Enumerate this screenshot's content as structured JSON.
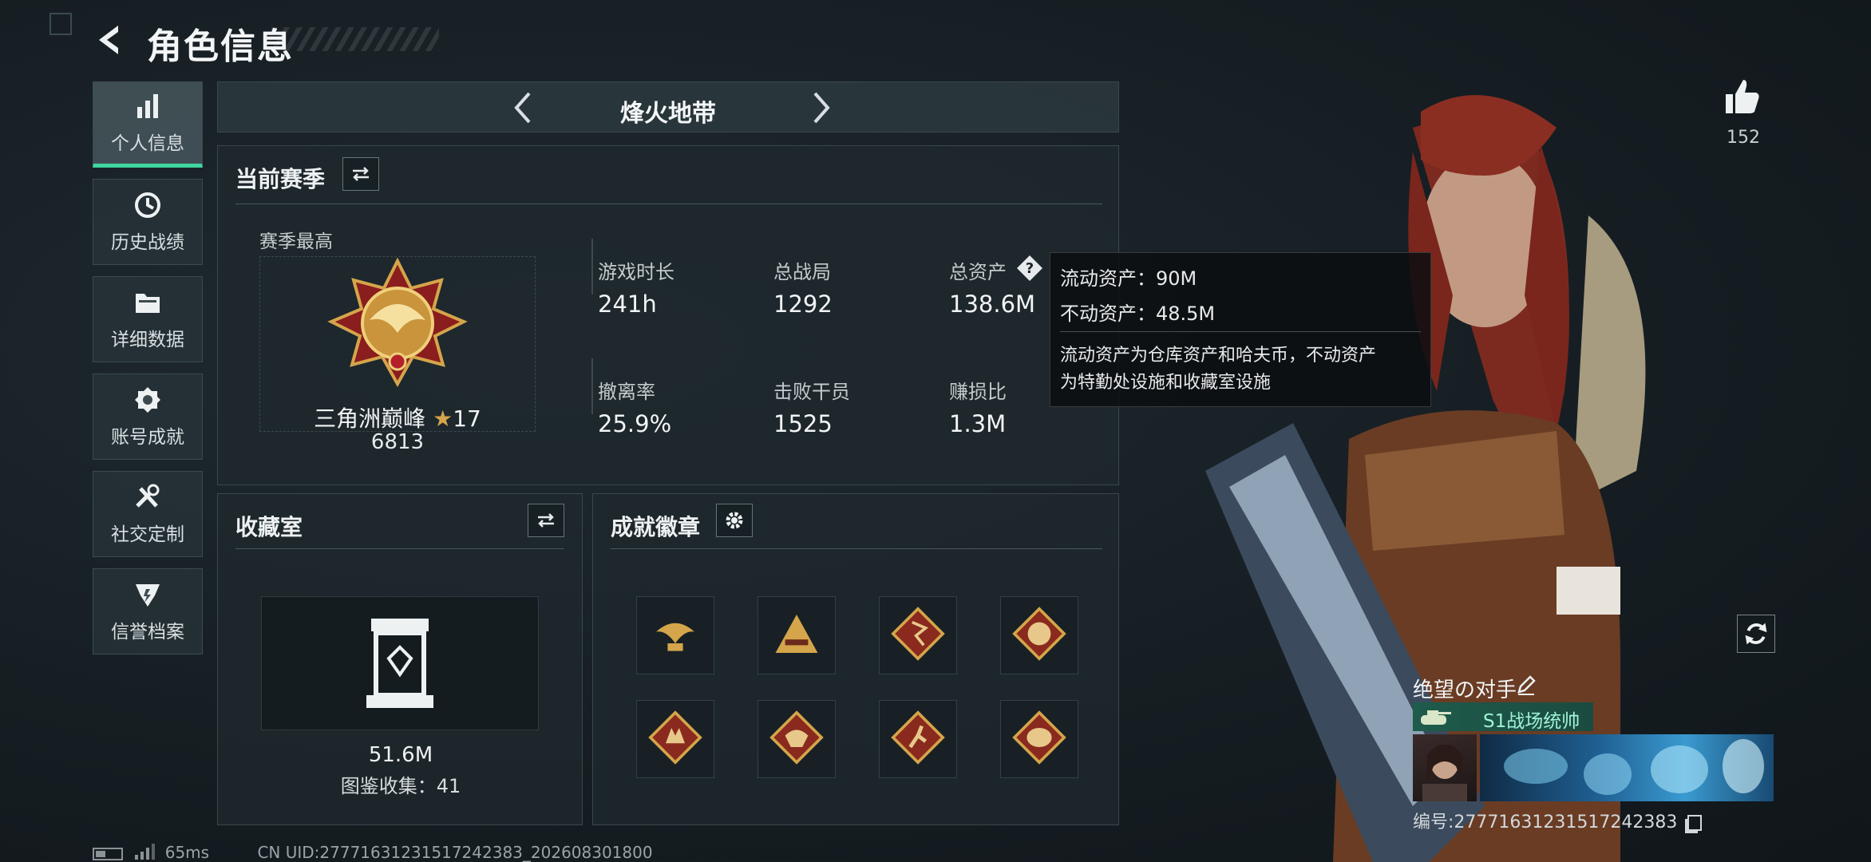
{
  "header": {
    "title": "角色信息"
  },
  "sidebar": {
    "items": [
      {
        "label": "个人信息",
        "icon": "bar-chart-icon",
        "active": true
      },
      {
        "label": "历史战绩",
        "icon": "history-clock-icon",
        "active": false
      },
      {
        "label": "详细数据",
        "icon": "folder-icon",
        "active": false
      },
      {
        "label": "账号成就",
        "icon": "achievement-medal-icon",
        "active": false
      },
      {
        "label": "社交定制",
        "icon": "wrench-tools-icon",
        "active": false
      },
      {
        "label": "信誉档案",
        "icon": "reputation-shield-icon",
        "active": false
      }
    ]
  },
  "mode_selector": {
    "name": "烽火地带"
  },
  "season": {
    "title": "当前赛季",
    "best_label": "赛季最高",
    "rank_name": "三角洲巅峰",
    "rank_stars": "17",
    "rank_points": "6813",
    "stats": [
      {
        "label": "游戏时长",
        "value": "241h"
      },
      {
        "label": "总战局",
        "value": "1292"
      },
      {
        "label": "总资产",
        "value": "138.6M"
      },
      {
        "label": "撤离率",
        "value": "25.9%"
      },
      {
        "label": "击败干员",
        "value": "1525"
      },
      {
        "label": "赚损比",
        "value": "1.3M"
      }
    ]
  },
  "tooltip": {
    "liquid": "流动资产：90M",
    "fixed": "不动资产：48.5M",
    "desc_line1": "流动资产为仓库资产和哈夫币，不动资产",
    "desc_line2": "为特勤处设施和收藏室设施"
  },
  "collection": {
    "title": "收藏室",
    "value": "51.6M",
    "catalog": "图鉴收集：41"
  },
  "badges": {
    "title": "成就徽章",
    "items": [
      "eagle-crest-badge-icon",
      "pyramid-badge-icon",
      "bolt-diamond-badge-icon",
      "dragon-diamond-badge-icon",
      "wolf-diamond-badge-icon",
      "dragon-head-badge-icon",
      "runner-diamond-badge-icon",
      "beast-diamond-badge-icon"
    ]
  },
  "profile": {
    "likes": "152",
    "player_name": "绝望の对手",
    "title_tag": "S1战场统帅",
    "id_line": "编号:27771631231517242383"
  },
  "status_bar": {
    "ping": "65ms",
    "uid": "CN UID:27771631231517242383_202608301800"
  },
  "colors": {
    "accent": "#3fd6a0",
    "gold": "#d4a54a",
    "tooltip_bg": "#0c0e10"
  }
}
